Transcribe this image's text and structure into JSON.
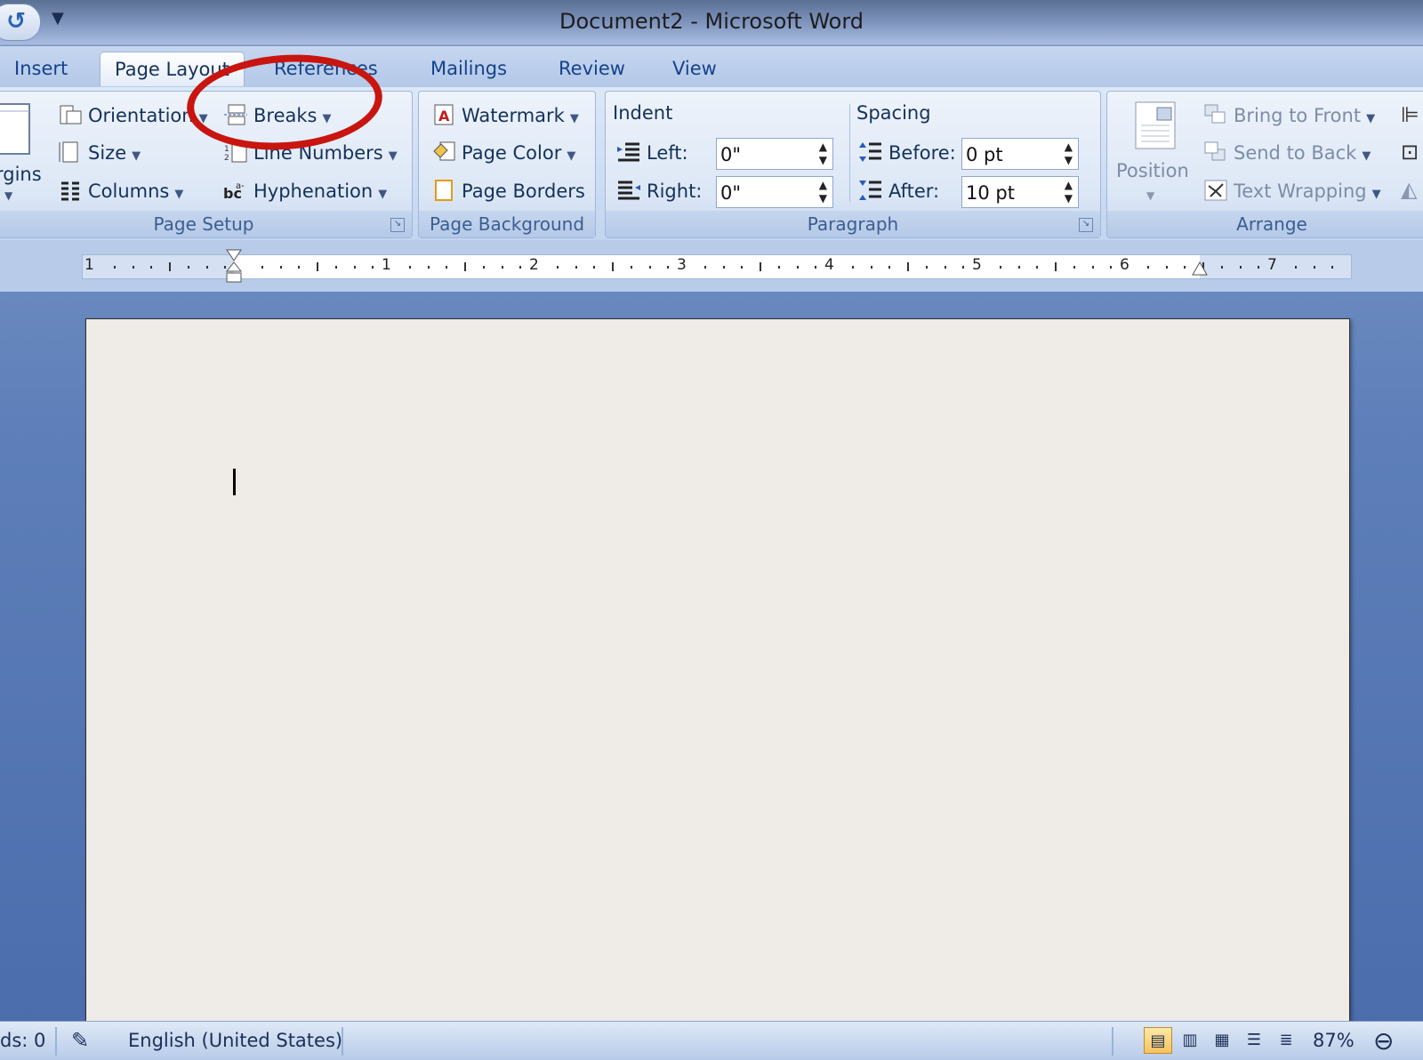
{
  "window": {
    "title": "Document2 - Microsoft Word",
    "qat_undo": "↺",
    "qat_menu": "▼"
  },
  "tabs": [
    {
      "label": "Insert"
    },
    {
      "label": "Page Layout"
    },
    {
      "label": "References"
    },
    {
      "label": "Mailings"
    },
    {
      "label": "Review"
    },
    {
      "label": "View"
    }
  ],
  "ribbon": {
    "page_setup": {
      "margins": "rgins",
      "orientation": "Orientation",
      "size": "Size",
      "columns": "Columns",
      "breaks": "Breaks",
      "line_numbers": "Line Numbers",
      "hyphenation": "Hyphenation",
      "label": "Page Setup"
    },
    "page_background": {
      "watermark": "Watermark",
      "page_color": "Page Color",
      "page_borders": "Page Borders",
      "label": "Page Background"
    },
    "paragraph": {
      "indent_title": "Indent",
      "left_label": "Left:",
      "left_value": "0\"",
      "right_label": "Right:",
      "right_value": "0\"",
      "spacing_title": "Spacing",
      "before_label": "Before:",
      "before_value": "0 pt",
      "after_label": "After:",
      "after_value": "10 pt",
      "label": "Paragraph"
    },
    "arrange": {
      "position": "Position",
      "bring_to_front": "Bring to Front",
      "send_to_back": "Send to Back",
      "text_wrapping": "Text Wrapping",
      "label": "Arrange"
    }
  },
  "ruler": {
    "numbers": [
      "1",
      "1",
      "2",
      "3",
      "4",
      "5",
      "6",
      "7"
    ]
  },
  "status": {
    "words": "ds: 0",
    "language": "English (United States)",
    "zoom": "87%"
  }
}
